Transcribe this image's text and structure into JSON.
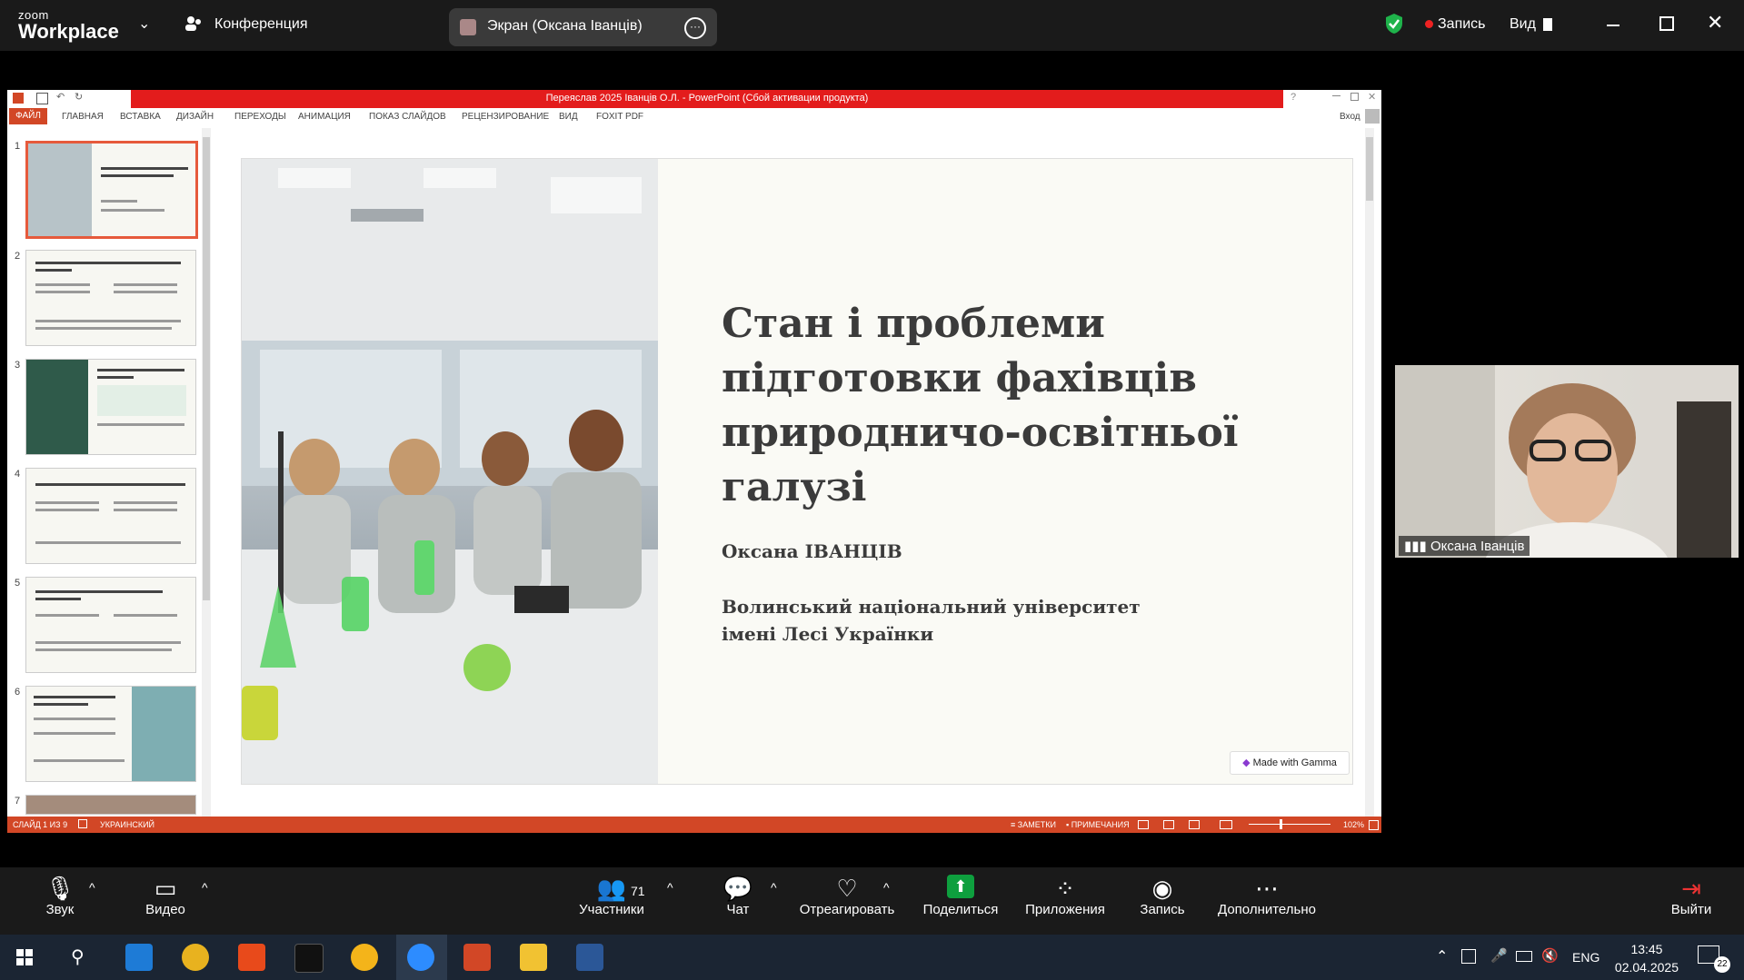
{
  "zoom": {
    "logo_small": "zoom",
    "logo_big": "Workplace",
    "meeting_label": "Конференция",
    "share_label": "Экран (Оксана Іванців)",
    "record_label": "Запись",
    "view_label": "Вид"
  },
  "powerpoint": {
    "title": "Переяслав 2025 Іванців О.Л. - PowerPoint (Сбой активации продукта)",
    "tabs": [
      "ФАЙЛ",
      "ГЛАВНАЯ",
      "ВСТАВКА",
      "ДИЗАЙН",
      "ПЕРЕХОДЫ",
      "АНИМАЦИЯ",
      "ПОКАЗ СЛАЙДОВ",
      "РЕЦЕНЗИРОВАНИЕ",
      "ВИД",
      "FOXIT PDF"
    ],
    "signin": "Вход",
    "thumbnails": [
      {
        "num": "1",
        "title": "Стан і проблеми підготовки фахівців природничо-освітньої галузі"
      },
      {
        "num": "2",
        "title": "Світові тенденції та стан природничої освіти в Україні"
      },
      {
        "num": "3",
        "title": "Основні проблеми: Матеріально-технічна база"
      },
      {
        "num": "4",
        "title": "Проблема: Практична підготовка та викладачі"
      },
      {
        "num": "5",
        "title": "Проблема: Невідповідність програм та мотивації"
      },
      {
        "num": "6",
        "title": "Шляхи вдосконалення: Матеріально-технічна база"
      },
      {
        "num": "7",
        "title": ""
      }
    ],
    "slide": {
      "title": "Стан і проблеми підготовки фахівців природничо-освітньої галузі",
      "author": "Оксана ІВАНЦІВ",
      "university_line1": "Волинський національний університет",
      "university_line2": "імені Лесі Українки",
      "badge": "Made with Gamma"
    },
    "status": {
      "slide_counter": "СЛАЙД 1 ИЗ 9",
      "language": "УКРАИНСКИЙ",
      "notes": "ЗАМЕТКИ",
      "comments": "ПРИМЕЧАНИЯ",
      "zoom": "102%"
    }
  },
  "video_tile": {
    "name": "Оксана Іванців"
  },
  "toolbar": {
    "audio": "Звук",
    "video": "Видео",
    "participants": "Участники",
    "participants_count": "71",
    "chat": "Чат",
    "react": "Отреагировать",
    "share": "Поделиться",
    "apps": "Приложения",
    "record": "Запись",
    "more": "Дополнительно",
    "leave": "Выйти"
  },
  "taskbar": {
    "lang": "ENG",
    "time": "13:45",
    "date": "02.04.2025",
    "notifications": "22"
  },
  "colors": {
    "ppt_red": "#e31c1c",
    "ppt_orange": "#d24726",
    "zoom_bar": "#1a1a1a",
    "share_green": "#0e9f3e"
  }
}
